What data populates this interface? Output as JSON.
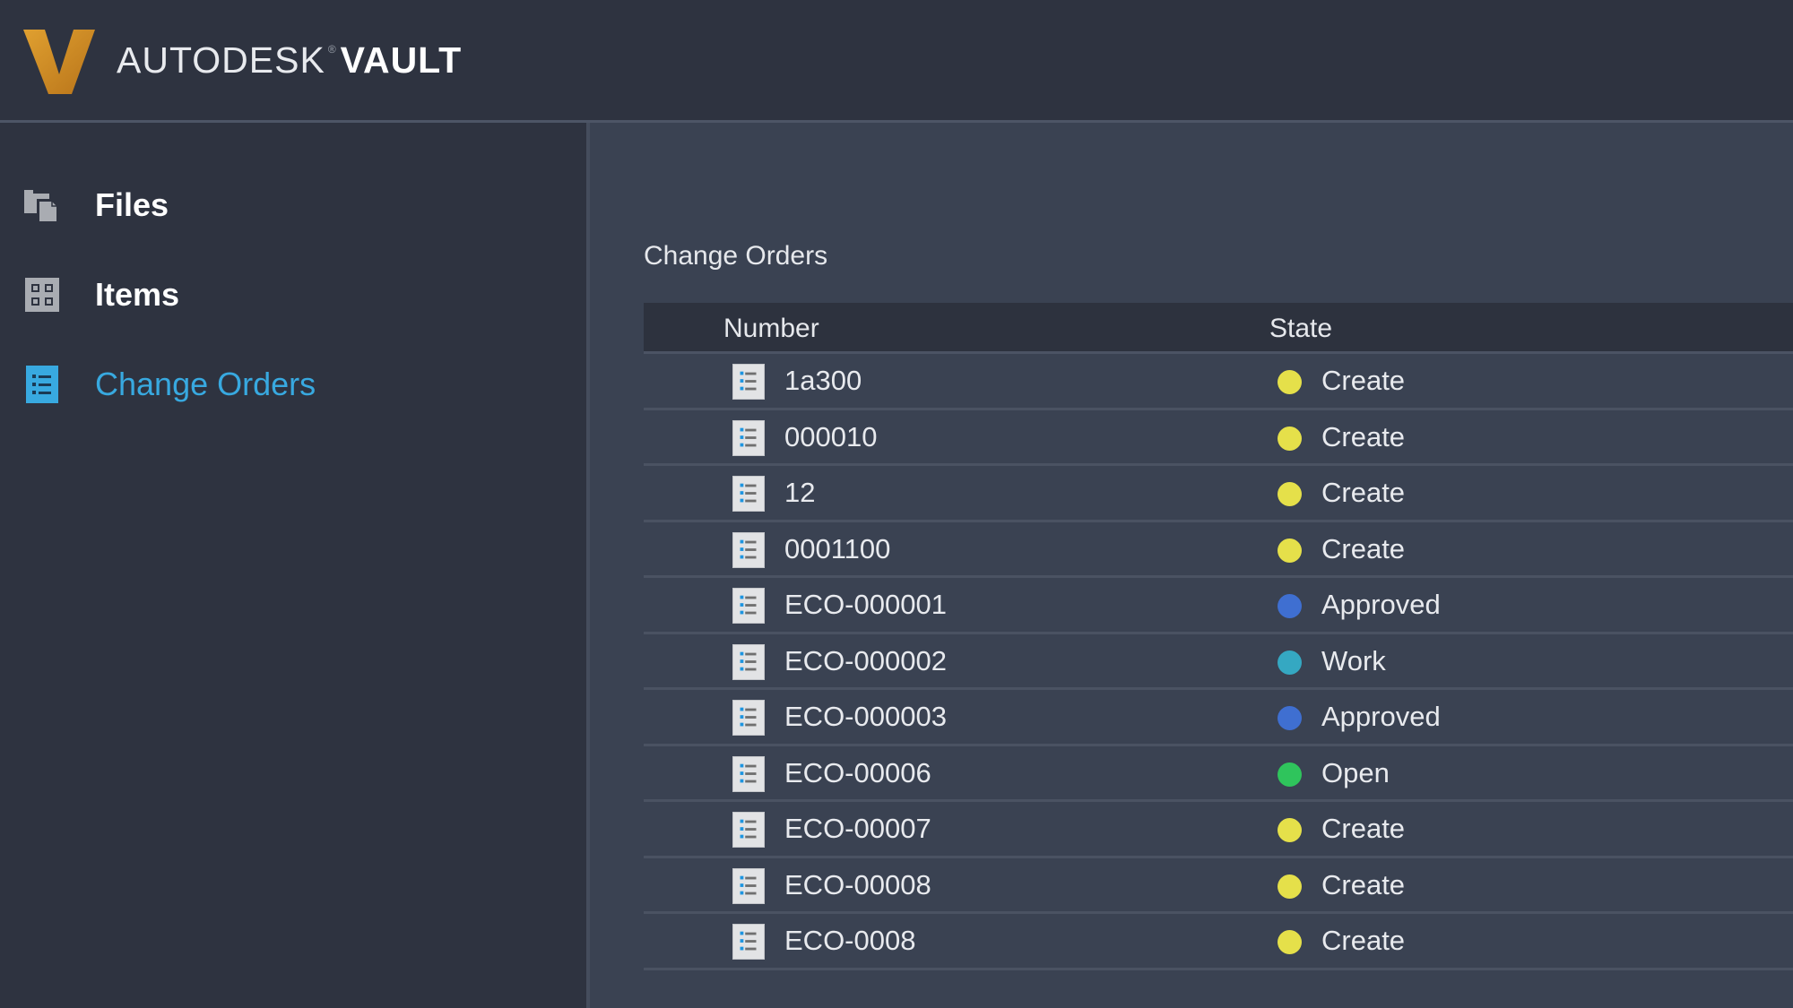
{
  "header": {
    "brand_light": "AUTODESK",
    "brand_reg": "®",
    "brand_bold": "VAULT",
    "logo_letter": "V",
    "logo_color": "#d08a1e"
  },
  "sidebar": {
    "items": [
      {
        "label": "Files",
        "icon": "files-icon",
        "active": false
      },
      {
        "label": "Items",
        "icon": "items-grid-icon",
        "active": false
      },
      {
        "label": "Change Orders",
        "icon": "change-order-list-icon",
        "active": true
      }
    ],
    "active_color": "#38a9e0"
  },
  "main": {
    "title": "Change Orders",
    "columns": [
      "Number",
      "State"
    ],
    "state_colors": {
      "Create": "#e5e04a",
      "Approved": "#3f6fd1",
      "Work": "#35a8c2",
      "Open": "#2fc45c"
    },
    "rows": [
      {
        "number": "1a300",
        "state": "Create"
      },
      {
        "number": "000010",
        "state": "Create"
      },
      {
        "number": "12",
        "state": "Create"
      },
      {
        "number": "0001100",
        "state": "Create"
      },
      {
        "number": "ECO-000001",
        "state": "Approved"
      },
      {
        "number": "ECO-000002",
        "state": "Work"
      },
      {
        "number": "ECO-000003",
        "state": "Approved"
      },
      {
        "number": "ECO-00006",
        "state": "Open"
      },
      {
        "number": "ECO-00007",
        "state": "Create"
      },
      {
        "number": "ECO-00008",
        "state": "Create"
      },
      {
        "number": "ECO-0008",
        "state": "Create"
      }
    ]
  }
}
